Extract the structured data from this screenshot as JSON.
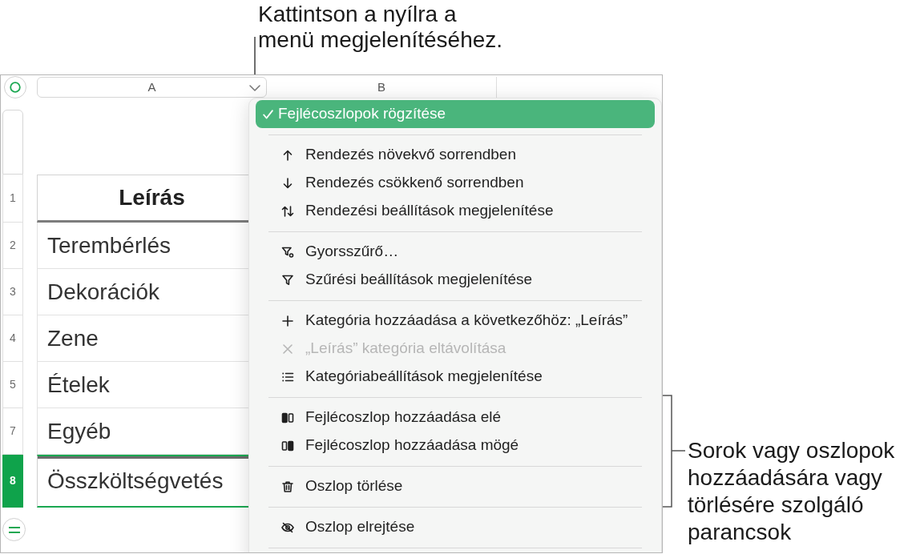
{
  "callouts": [
    {
      "lines": [
        "Kattintson a nyílra a",
        "menü megjelenítéséhez."
      ]
    },
    {
      "lines": [
        "Sorok vagy oszlopok",
        "hozzáadására vagy",
        "törlésére szolgáló",
        "parancsok"
      ]
    }
  ],
  "spreadsheet": {
    "columns": [
      {
        "label": "A",
        "selected": true
      },
      {
        "label": "B",
        "selected": false
      }
    ],
    "rows": [
      {
        "number": "1",
        "kind": "header",
        "cell": "Leírás",
        "selected": false
      },
      {
        "number": "2",
        "kind": "body",
        "cell": "Terembérlés",
        "selected": false
      },
      {
        "number": "3",
        "kind": "body",
        "cell": "Dekorációk",
        "selected": false
      },
      {
        "number": "4",
        "kind": "body",
        "cell": "Zene",
        "selected": false
      },
      {
        "number": "5",
        "kind": "body",
        "cell": "Ételek",
        "selected": false
      },
      {
        "number": "7",
        "kind": "body",
        "cell": "Egyéb",
        "selected": false
      },
      {
        "number": "8",
        "kind": "footer",
        "cell": "Összköltségvetés",
        "selected": true
      }
    ]
  },
  "menu": {
    "sections": [
      {
        "items": [
          {
            "kind": "toggle",
            "label": "Fejlécoszlopok rögzítése",
            "checked": true,
            "selected": true,
            "disabled": false
          }
        ]
      },
      {
        "items": [
          {
            "kind": "command",
            "label": "Rendezés növekvő sorrendben",
            "checked": false,
            "selected": false,
            "disabled": false
          },
          {
            "kind": "command",
            "label": "Rendezés csökkenő sorrendben",
            "checked": false,
            "selected": false,
            "disabled": false
          },
          {
            "kind": "command",
            "label": "Rendezési beállítások megjelenítése",
            "checked": false,
            "selected": false,
            "disabled": false
          }
        ]
      },
      {
        "items": [
          {
            "kind": "command",
            "label": "Gyorsszűrő…",
            "checked": false,
            "selected": false,
            "disabled": false
          },
          {
            "kind": "command",
            "label": "Szűrési beállítások megjelenítése",
            "checked": false,
            "selected": false,
            "disabled": false
          }
        ]
      },
      {
        "items": [
          {
            "kind": "command",
            "label": "Kategória hozzáadása a következőhöz: „Leírás”",
            "checked": false,
            "selected": false,
            "disabled": false
          },
          {
            "kind": "command",
            "label": "„Leírás” kategória eltávolítása",
            "checked": false,
            "selected": false,
            "disabled": true
          },
          {
            "kind": "command",
            "label": "Kategóriabeállítások megjelenítése",
            "checked": false,
            "selected": false,
            "disabled": false
          }
        ]
      },
      {
        "items": [
          {
            "kind": "command",
            "label": "Fejlécoszlop hozzáadása elé",
            "checked": false,
            "selected": false,
            "disabled": false
          },
          {
            "kind": "command",
            "label": "Fejlécoszlop hozzáadása mögé",
            "checked": false,
            "selected": false,
            "disabled": false
          }
        ]
      },
      {
        "items": [
          {
            "kind": "command",
            "label": "Oszlop törlése",
            "checked": false,
            "selected": false,
            "disabled": false
          }
        ]
      },
      {
        "items": [
          {
            "kind": "command",
            "label": "Oszlop elrejtése",
            "checked": false,
            "selected": false,
            "disabled": false
          }
        ]
      }
    ]
  }
}
